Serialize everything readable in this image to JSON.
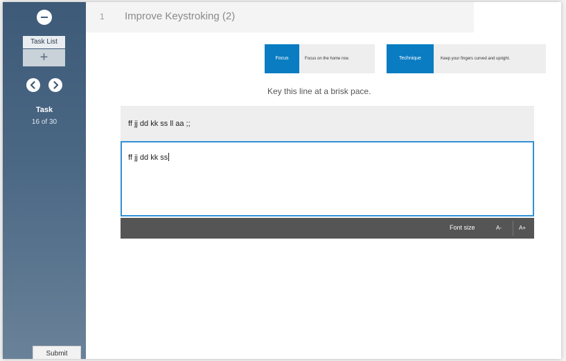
{
  "sidebar": {
    "task_list_label": "Task List",
    "add_glyph": "+",
    "task_label": "Task",
    "task_progress": "16 of 30",
    "submit_label": "Submit"
  },
  "header": {
    "number": "1",
    "title": "Improve Keystroking (2)"
  },
  "tips": {
    "focus_label": "Focus",
    "focus_text": "Focus on the home row.",
    "technique_label": "Technique",
    "technique_text": "Keep your fingers curved and upright."
  },
  "instruction": "Key this line at a brisk pace.",
  "prompt": {
    "line": "ff jj dd kk ss ll aa ;;",
    "typed": "ff jj dd kk ss"
  },
  "toolbar": {
    "font_size_label": "Font size",
    "decrease_label": "A-",
    "increase_label": "A+"
  },
  "colors": {
    "accent": "#0a7cc2",
    "input_border": "#2e8fd6",
    "sidebar": "#4a6784",
    "toolbar": "#555555"
  }
}
